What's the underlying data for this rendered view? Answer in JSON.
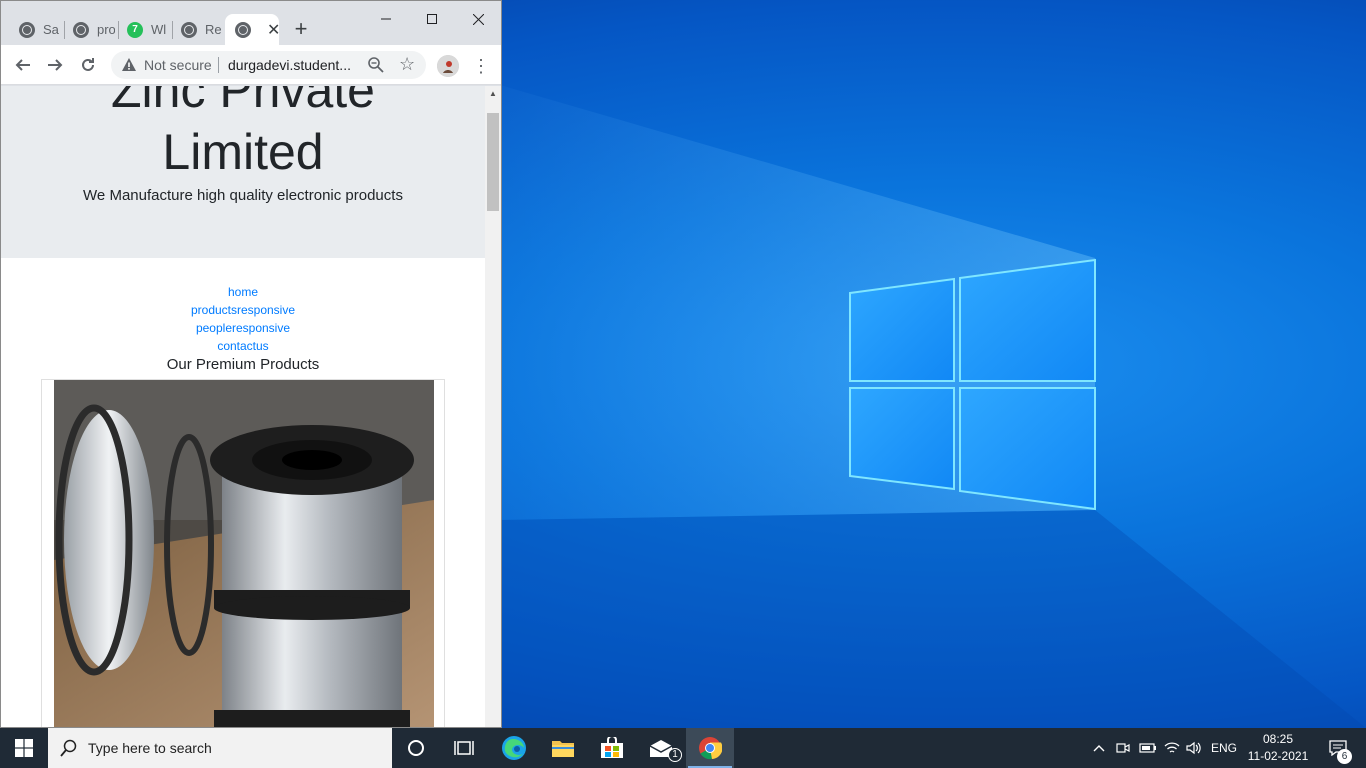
{
  "browser": {
    "tabs": [
      {
        "label": "Sa",
        "favicon": "globe-icon"
      },
      {
        "label": "pro",
        "favicon": "globe-icon"
      },
      {
        "label": "Wl",
        "favicon": "green-badge-icon",
        "badge": "7"
      },
      {
        "label": "Re",
        "favicon": "globe-icon"
      },
      {
        "label": "",
        "favicon": "globe-icon",
        "active": true
      }
    ],
    "security_label": "Not secure",
    "url": "durgadevi.student..."
  },
  "page": {
    "title_line1": "Zinc Private",
    "title_line2": "Limited",
    "subtitle": "We Manufacture high quality electronic products",
    "nav": [
      "home",
      "productsresponsive",
      "peopleresponsive",
      "contactus"
    ],
    "section_title": "Our Premium Products",
    "link_color": "#007bff",
    "jumbotron_color": "#e9ecef"
  },
  "taskbar": {
    "search_placeholder": "Type here to search",
    "mail_badge": "1",
    "language": "ENG",
    "time": "08:25",
    "date": "11-02-2021",
    "notification_count": "6"
  },
  "colors": {
    "taskbar": "#1f2a36",
    "desktop_accent": "#0a74dc"
  }
}
